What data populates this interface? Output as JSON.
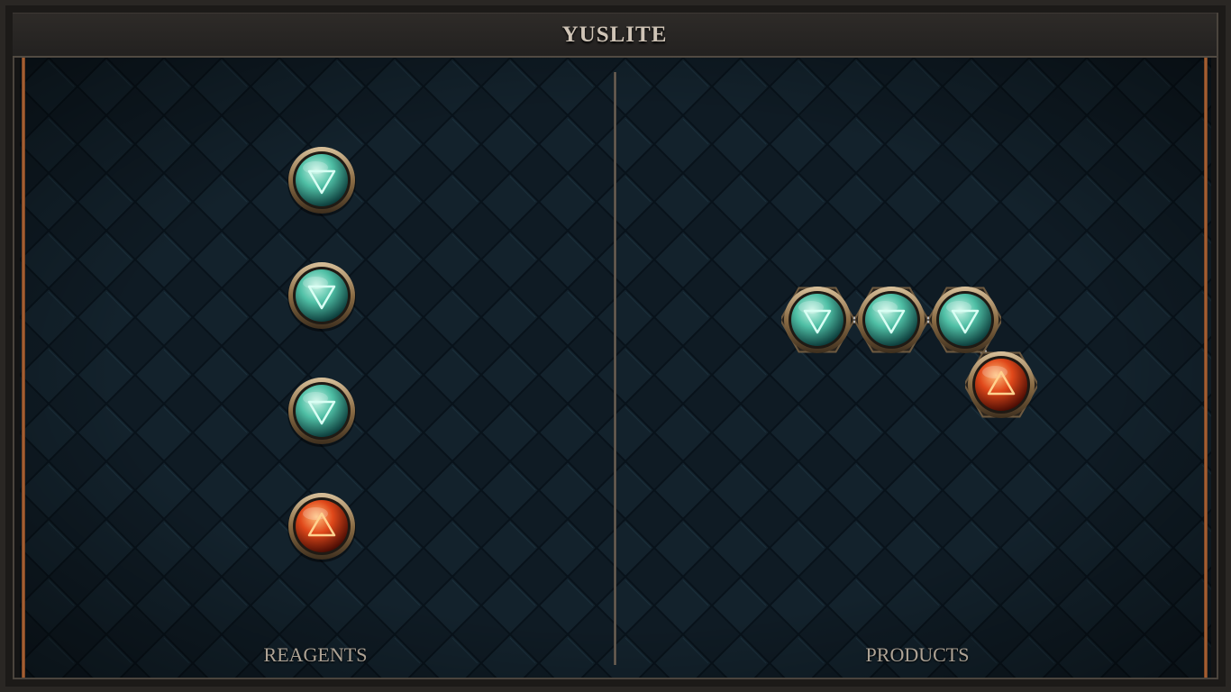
{
  "title": "YUSLITE",
  "sections": {
    "reagents_label": "REAGENTS",
    "products_label": "PRODUCTS"
  },
  "reagents": [
    {
      "element": "water",
      "symbol": "water-triangle-icon"
    },
    {
      "element": "water",
      "symbol": "water-triangle-icon"
    },
    {
      "element": "water",
      "symbol": "water-triangle-icon"
    },
    {
      "element": "fire",
      "symbol": "fire-triangle-icon"
    }
  ],
  "products": [
    {
      "element": "water",
      "symbol": "water-triangle-icon"
    },
    {
      "element": "water",
      "symbol": "water-triangle-icon"
    },
    {
      "element": "water",
      "symbol": "water-triangle-icon"
    },
    {
      "element": "fire",
      "symbol": "fire-triangle-icon"
    }
  ],
  "product_bonds": [
    {
      "from": 0,
      "to": 1
    },
    {
      "from": 1,
      "to": 2
    },
    {
      "from": 2,
      "to": 3
    }
  ],
  "colors": {
    "water": "#49c1a8",
    "fire": "#e0481a",
    "bronze": "#a88b62",
    "background": "#0f1b24",
    "label": "#aea395"
  }
}
